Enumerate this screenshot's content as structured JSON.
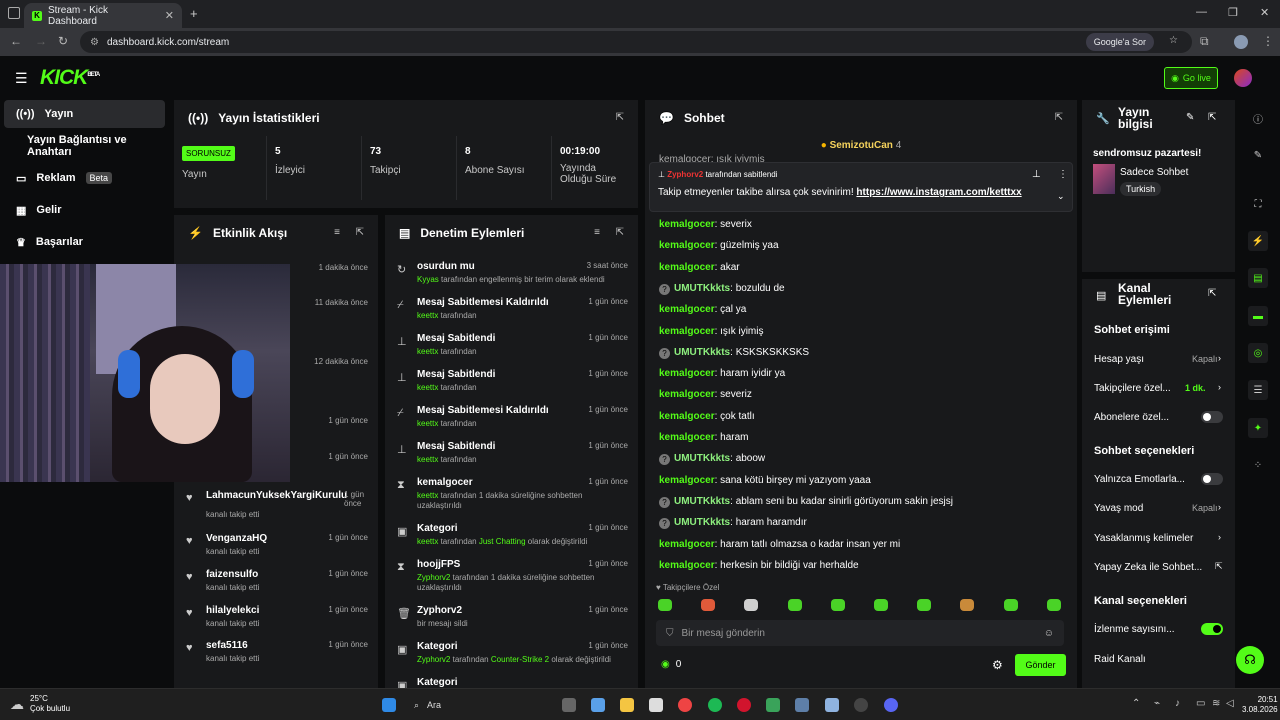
{
  "browser": {
    "tab_title": "Stream - Kick Dashboard",
    "url": "dashboard.kick.com/stream",
    "ask_google": "Google'a Sor"
  },
  "header": {
    "logo": "KICK",
    "logo_beta": "BETA",
    "go_live": "Go live"
  },
  "sidebar": {
    "items": [
      {
        "label": "Yayın"
      },
      {
        "label": "Yayın Bağlantısı ve Anahtarı"
      },
      {
        "label": "Reklam",
        "badge": "Beta"
      },
      {
        "label": "Gelir"
      },
      {
        "label": "Başarılar"
      }
    ]
  },
  "stats": {
    "title": "Yayın İstatistikleri",
    "status_badge": "SORUNSUZ",
    "status_label": "Yayın",
    "items": [
      {
        "value": "5",
        "label": "İzleyici"
      },
      {
        "value": "73",
        "label": "Takipçi"
      },
      {
        "value": "8",
        "label": "Abone Sayısı"
      },
      {
        "value": "00:19:00",
        "label": "Yayında Olduğu Süre"
      }
    ]
  },
  "activity": {
    "title": "Etkinlik Akışı",
    "partial_items": [
      {
        "time": "1 dakika önce"
      },
      {
        "time": "11 dakika önce"
      },
      {
        "time": "12 dakika önce"
      },
      {
        "time": "1 gün önce"
      },
      {
        "time": "1 gün önce"
      }
    ],
    "items": [
      {
        "user": "LahmacunYuksekYargiKurulu",
        "action": "kanalı takip etti",
        "time": "1 gün önce"
      },
      {
        "user": "VenganzaHQ",
        "action": "kanalı takip etti",
        "time": "1 gün önce"
      },
      {
        "user": "faizensulfo",
        "action": "kanalı takip etti",
        "time": "1 gün önce"
      },
      {
        "user": "hilalyelekci",
        "action": "kanalı takip etti",
        "time": "1 gün önce"
      },
      {
        "user": "sefa5116",
        "action": "kanalı takip etti",
        "time": "1 gün önce"
      }
    ]
  },
  "moderation": {
    "title": "Denetim Eylemleri",
    "items": [
      {
        "title": "osurdun mu",
        "who": "Kyyas",
        "rest": "tarafından engellenmiş bir terim olarak eklendi",
        "time": "3 saat önce"
      },
      {
        "title": "Mesaj Sabitlemesi Kaldırıldı",
        "who": "keettx",
        "rest": "tarafından",
        "time": "1 gün önce"
      },
      {
        "title": "Mesaj Sabitlendi",
        "who": "keettx",
        "rest": "tarafından",
        "time": "1 gün önce"
      },
      {
        "title": "Mesaj Sabitlendi",
        "who": "keettx",
        "rest": "tarafından",
        "time": "1 gün önce"
      },
      {
        "title": "Mesaj Sabitlemesi Kaldırıldı",
        "who": "keettx",
        "rest": "tarafından",
        "time": "1 gün önce"
      },
      {
        "title": "Mesaj Sabitlendi",
        "who": "keettx",
        "rest": "tarafından",
        "time": "1 gün önce"
      },
      {
        "title": "kemalgocer",
        "who": "keettx",
        "rest": "tarafından 1 dakika süreliğine sohbetten uzaklaştırıldı",
        "time": "1 gün önce"
      },
      {
        "title": "Kategori",
        "who": "keettx",
        "rest": "tarafından",
        "cat": "Just Chatting",
        "rest2": "olarak değiştirildi",
        "time": "1 gün önce"
      },
      {
        "title": "hoojjFPS",
        "who": "Zyphorv2",
        "rest": "tarafından 1 dakika süreliğine sohbetten uzaklaştırıldı",
        "time": "1 gün önce"
      },
      {
        "title": "Zyphorv2",
        "who": "",
        "rest": "bir mesajı sildi",
        "time": "1 gün önce"
      },
      {
        "title": "Kategori",
        "who": "Zyphorv2",
        "rest": "tarafından",
        "cat": "Counter-Strike 2",
        "rest2": "olarak değiştirildi",
        "time": "1 gün önce"
      },
      {
        "title": "Kategori",
        "who": "",
        "rest": "",
        "time": ""
      }
    ]
  },
  "chat": {
    "title": "Sohbet",
    "top_user": "SemizotuCan",
    "top_count": "4",
    "partial_line": "kemalgocer: ışık iyiymiş",
    "pinned_by": "Zyphorv2",
    "pinned_label": "tarafından sabitlendi",
    "pinned_text": "Takip etmeyenler takibe alırsa çok sevinirim!",
    "pinned_link": "https://www.instagram.com/ketttxx",
    "messages": [
      {
        "user": "kemalgocer",
        "text": "severix",
        "badge": false
      },
      {
        "user": "kemalgocer",
        "text": "güzelmiş yaa",
        "badge": false
      },
      {
        "user": "kemalgocer",
        "text": "akar",
        "badge": false
      },
      {
        "user": "UMUTKkkts",
        "text": "bozuldu de",
        "badge": true
      },
      {
        "user": "kemalgocer",
        "text": "çal ya",
        "badge": false
      },
      {
        "user": "kemalgocer",
        "text": "ışık iyimiş",
        "badge": false
      },
      {
        "user": "UMUTKkkts",
        "text": "KSKSKSKKSKS",
        "badge": true
      },
      {
        "user": "kemalgocer",
        "text": "haram iyidir ya",
        "badge": false
      },
      {
        "user": "kemalgocer",
        "text": "severiz",
        "badge": false
      },
      {
        "user": "kemalgocer",
        "text": "çok tatlı",
        "badge": false
      },
      {
        "user": "kemalgocer",
        "text": "haram",
        "badge": false
      },
      {
        "user": "UMUTKkkts",
        "text": "aboow",
        "badge": true
      },
      {
        "user": "kemalgocer",
        "text": "sana kötü birşey mi yazıyom yaaa",
        "badge": false
      },
      {
        "user": "UMUTKkkts",
        "text": "ablam seni bu kadar sinirli görüyorum sakin jesjsj",
        "badge": true
      },
      {
        "user": "UMUTKkkts",
        "text": "haram haramdır",
        "badge": true
      },
      {
        "user": "kemalgocer",
        "text": "haram tatlı olmazsa o kadar insan yer mi",
        "badge": false
      },
      {
        "user": "kemalgocer",
        "text": "herkesin bir bildiği var herhalde",
        "badge": false
      }
    ],
    "followers_only": "Takipçilere Özel",
    "placeholder": "Bir mesaj gönderin",
    "points": "0",
    "send": "Gönder"
  },
  "stream_info": {
    "title": "Yayın bilgisi",
    "stream_title": "sendromsuz pazartesi!",
    "category": "Sadece Sohbet",
    "tag": "Turkish"
  },
  "channel_actions": {
    "title": "Kanal Eylemleri",
    "chat_access": "Sohbet erişimi",
    "account_age": "Hesap yaşı",
    "account_age_val": "Kapalı",
    "followers_only": "Takipçilere özel...",
    "followers_only_val": "1 dk.",
    "subscribers_only": "Abonelere özel...",
    "chat_options": "Sohbet seçenekleri",
    "emote_only": "Yalnızca Emotlarla...",
    "slow_mode": "Yavaş mod",
    "slow_mode_val": "Kapalı",
    "banned_words": "Yasaklanmış kelimeler",
    "ai_chat": "Yapay Zeka ile Sohbet...",
    "channel_options": "Kanal seçenekleri",
    "view_count": "İzlenme sayısını...",
    "raid": "Raid Kanalı"
  },
  "taskbar": {
    "temp": "25°C",
    "weather": "Çok bulutlu",
    "search": "Ara",
    "time": "20:51",
    "date": "3.08.2026"
  },
  "colors": {
    "accent": "#53fc18",
    "panel": "#18191b",
    "bg": "#0b0c0d"
  }
}
